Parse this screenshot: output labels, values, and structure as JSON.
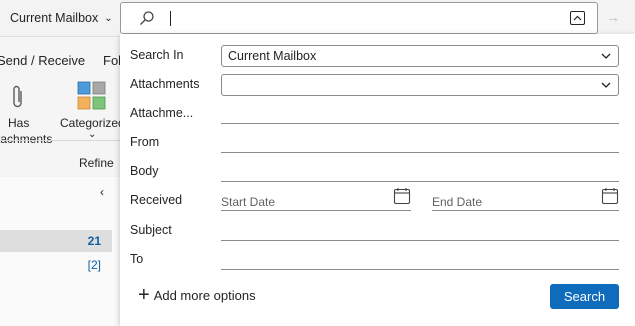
{
  "scope": {
    "label": "Current Mailbox"
  },
  "ribbon": {
    "tab_send_receive": "Send / Receive",
    "tab_fol": "Fol",
    "has_attachments_line1": "Has",
    "has_attachments_line2": "attachments",
    "categorized": "Categorized",
    "refine": "Refine"
  },
  "list": {
    "count_1": "21",
    "count_2": "[2]"
  },
  "panel": {
    "search_in_label": "Search In",
    "search_in_value": "Current Mailbox",
    "attachments_label": "Attachments",
    "attachments_value": "",
    "attachment_name_label": "Attachme...",
    "from_label": "From",
    "body_label": "Body",
    "received_label": "Received",
    "start_date_placeholder": "Start Date",
    "end_date_placeholder": "End Date",
    "subject_label": "Subject",
    "to_label": "To",
    "add_more_label": "Add more options",
    "search_button": "Search"
  },
  "icons": {
    "search": "search-icon",
    "collapse": "chevron-up-icon",
    "go": "arrow-right-icon",
    "paperclip": "paperclip-icon",
    "categories": "categories-grid-icon",
    "calendar": "calendar-icon",
    "plus": "plus-icon",
    "dropdown": "chevron-down-icon",
    "collapse_pane": "chevron-left-icon"
  },
  "colors": {
    "accent": "#0f6cbd",
    "count_blue": "#115ea3",
    "cat_blue": "#4f9ad8",
    "cat_gray": "#a8a8a8",
    "cat_orange": "#f2b15a",
    "cat_green": "#7ec47a"
  }
}
